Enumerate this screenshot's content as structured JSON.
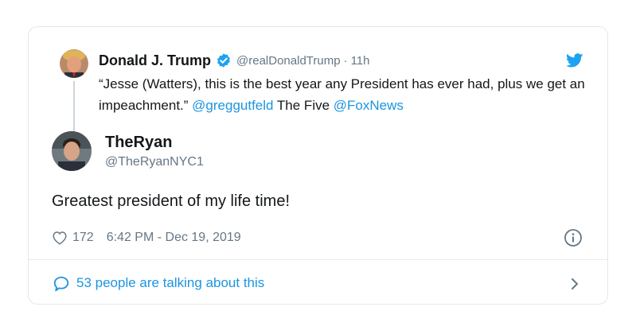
{
  "parent_tweet": {
    "author_name": "Donald J. Trump",
    "handle": "@realDonaldTrump",
    "separator": "·",
    "time": "11h",
    "text_parts": [
      {
        "text": "“Jesse (Watters), this is the best year any President has ever had, plus we get an impeachment.” ",
        "link": false
      },
      {
        "text": "@greggutfeld",
        "link": true
      },
      {
        "text": " The Five ",
        "link": false
      },
      {
        "text": "@FoxNews",
        "link": true
      }
    ],
    "verified_icon": "verified-badge-icon",
    "brand_icon": "twitter-bird-icon"
  },
  "reply_tweet": {
    "author_name": "TheRyan",
    "handle": "@TheRyanNYC1",
    "text": "Greatest president of my life time!",
    "likes": "172",
    "timestamp": "6:42 PM - Dec 19, 2019"
  },
  "footer": {
    "talking_text": "53 people are talking about this"
  },
  "colors": {
    "link": "#1b95e0",
    "muted": "#657786",
    "border": "#e1e8ed"
  }
}
